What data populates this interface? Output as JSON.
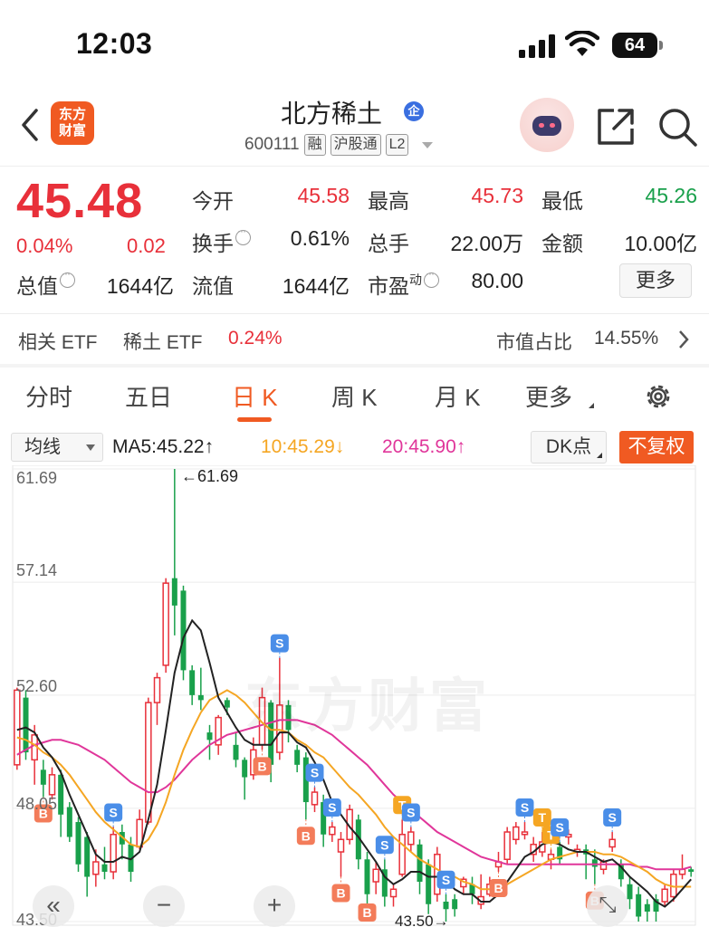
{
  "status": {
    "time": "12:03",
    "battery": "64"
  },
  "header": {
    "logo_line1": "东方",
    "logo_line2": "财富",
    "stock_name": "北方稀土",
    "badge": "企",
    "code": "600111",
    "tags": [
      "融",
      "沪股通",
      "L2"
    ]
  },
  "quote": {
    "price": "45.48",
    "change_pct": "0.04%",
    "change_val": "0.02",
    "fields": {
      "open_label": "今开",
      "open": "45.58",
      "high_label": "最高",
      "high": "45.73",
      "low_label": "最低",
      "low": "45.26",
      "turnover_label": "换手",
      "turnover": "0.61%",
      "volume_label": "总手",
      "volume": "22.00万",
      "amount_label": "金额",
      "amount": "10.00亿",
      "mktcap_label": "总值",
      "mktcap": "1644亿",
      "float_label": "流值",
      "float": "1644亿",
      "pe_label": "市盈",
      "pe_sup": "动",
      "pe": "80.00"
    },
    "more_label": "更多"
  },
  "etf": {
    "related": "相关 ETF",
    "rare_earth": "稀土 ETF",
    "rare_earth_pct": "0.24%",
    "mktcap_share_label": "市值占比",
    "mktcap_share": "14.55%"
  },
  "tabs": [
    "分时",
    "五日",
    "日 K",
    "周 K",
    "月 K",
    "更多"
  ],
  "active_tab": "日 K",
  "ma_row": {
    "indicator": "均线",
    "ma5": "MA5:45.22↑",
    "ma10": "10:45.29↓",
    "ma20": "20:45.90↑",
    "dk": "DK点",
    "adjust": "不复权"
  },
  "colors": {
    "up": "#e8303a",
    "down": "#19a04b",
    "accent": "#f05a22",
    "ma5": "#222222",
    "ma10": "#f5a623",
    "ma20": "#e0369a",
    "buy_marker": "#f37c5a",
    "sell_marker": "#4a8ee8",
    "t_marker": "#f5a623"
  },
  "chart_data": {
    "type": "candlestick",
    "y_axis_ticks": [
      "61.69",
      "57.14",
      "52.60",
      "48.05",
      "43.50"
    ],
    "ylim": [
      43.5,
      61.69
    ],
    "max_label": "61.69",
    "min_label": "43.50",
    "watermark": "东方财富",
    "candles": [
      {
        "o": 49.8,
        "c": 52.8,
        "h": 52.9,
        "l": 49.6
      },
      {
        "o": 52.5,
        "c": 50.3,
        "h": 52.8,
        "l": 50.0
      },
      {
        "o": 50.0,
        "c": 51.0,
        "h": 51.4,
        "l": 49.0
      },
      {
        "o": 49.6,
        "c": 49.0,
        "h": 50.0,
        "l": 48.5
      },
      {
        "o": 48.6,
        "c": 49.4,
        "h": 49.7,
        "l": 48.4
      },
      {
        "o": 49.4,
        "c": 47.8,
        "h": 49.6,
        "l": 46.9
      },
      {
        "o": 48.1,
        "c": 46.9,
        "h": 48.3,
        "l": 46.7
      },
      {
        "o": 47.5,
        "c": 45.8,
        "h": 47.7,
        "l": 45.5
      },
      {
        "o": 46.9,
        "c": 45.3,
        "h": 47.1,
        "l": 44.5
      },
      {
        "o": 45.4,
        "c": 45.9,
        "h": 46.4,
        "l": 44.9
      },
      {
        "o": 45.8,
        "c": 45.5,
        "h": 46.5,
        "l": 45.2
      },
      {
        "o": 45.5,
        "c": 47.0,
        "h": 47.3,
        "l": 45.2
      },
      {
        "o": 47.1,
        "c": 46.6,
        "h": 47.4,
        "l": 46.0
      },
      {
        "o": 46.6,
        "c": 45.5,
        "h": 46.9,
        "l": 45.1
      },
      {
        "o": 46.5,
        "c": 47.6,
        "h": 48.0,
        "l": 46.4
      },
      {
        "o": 47.5,
        "c": 52.3,
        "h": 52.5,
        "l": 47.4
      },
      {
        "o": 52.3,
        "c": 53.3,
        "h": 53.5,
        "l": 51.4
      },
      {
        "o": 53.8,
        "c": 57.1,
        "h": 57.3,
        "l": 53.5
      },
      {
        "o": 57.3,
        "c": 56.2,
        "h": 61.69,
        "l": 55.0
      },
      {
        "o": 56.8,
        "c": 53.6,
        "h": 57.0,
        "l": 53.2
      },
      {
        "o": 53.6,
        "c": 52.6,
        "h": 53.8,
        "l": 52.2
      },
      {
        "o": 52.6,
        "c": 52.4,
        "h": 53.7,
        "l": 52.0
      },
      {
        "o": 51.1,
        "c": 50.8,
        "h": 51.4,
        "l": 50.0
      },
      {
        "o": 50.6,
        "c": 51.7,
        "h": 51.8,
        "l": 50.2
      },
      {
        "o": 52.4,
        "c": 52.1,
        "h": 52.5,
        "l": 51.8
      },
      {
        "o": 50.6,
        "c": 50.0,
        "h": 51.1,
        "l": 49.7
      },
      {
        "o": 50.0,
        "c": 49.3,
        "h": 50.1,
        "l": 48.4
      },
      {
        "o": 49.4,
        "c": 50.4,
        "h": 50.9,
        "l": 49.2
      },
      {
        "o": 50.6,
        "c": 52.5,
        "h": 52.9,
        "l": 50.4
      },
      {
        "o": 52.3,
        "c": 49.8,
        "h": 52.4,
        "l": 49.1
      },
      {
        "o": 50.3,
        "c": 52.2,
        "h": 54.1,
        "l": 50.0
      },
      {
        "o": 52.2,
        "c": 51.2,
        "h": 52.4,
        "l": 50.7
      },
      {
        "o": 50.4,
        "c": 49.8,
        "h": 50.6,
        "l": 49.5
      },
      {
        "o": 50.1,
        "c": 48.3,
        "h": 50.3,
        "l": 47.6
      },
      {
        "o": 48.2,
        "c": 48.7,
        "h": 48.9,
        "l": 47.9
      },
      {
        "o": 48.3,
        "c": 47.0,
        "h": 48.6,
        "l": 46.5
      },
      {
        "o": 47.0,
        "c": 47.3,
        "h": 47.5,
        "l": 46.7
      },
      {
        "o": 46.3,
        "c": 46.8,
        "h": 47.1,
        "l": 45.3
      },
      {
        "o": 46.8,
        "c": 48.0,
        "h": 48.2,
        "l": 46.6
      },
      {
        "o": 47.6,
        "c": 46.0,
        "h": 47.8,
        "l": 45.6
      },
      {
        "o": 46.0,
        "c": 44.6,
        "h": 46.3,
        "l": 44.2
      },
      {
        "o": 45.1,
        "c": 45.6,
        "h": 45.9,
        "l": 44.6
      },
      {
        "o": 45.6,
        "c": 44.5,
        "h": 46.0,
        "l": 44.1
      },
      {
        "o": 44.5,
        "c": 44.8,
        "h": 45.0,
        "l": 44.1
      },
      {
        "o": 45.4,
        "c": 47.0,
        "h": 47.6,
        "l": 45.3
      },
      {
        "o": 46.6,
        "c": 47.1,
        "h": 47.3,
        "l": 46.3
      },
      {
        "o": 46.6,
        "c": 45.1,
        "h": 46.8,
        "l": 44.6
      },
      {
        "o": 45.8,
        "c": 44.2,
        "h": 46.0,
        "l": 43.8
      },
      {
        "o": 44.6,
        "c": 46.2,
        "h": 46.5,
        "l": 44.3
      },
      {
        "o": 44.3,
        "c": 44.0,
        "h": 44.6,
        "l": 43.5
      },
      {
        "o": 44.4,
        "c": 44.0,
        "h": 44.6,
        "l": 43.7
      },
      {
        "o": 44.9,
        "c": 45.2,
        "h": 45.3,
        "l": 44.6
      },
      {
        "o": 45.0,
        "c": 44.6,
        "h": 45.3,
        "l": 44.2
      },
      {
        "o": 44.2,
        "c": 44.5,
        "h": 45.4,
        "l": 44.0
      },
      {
        "o": 44.6,
        "c": 45.0,
        "h": 45.3,
        "l": 44.5
      },
      {
        "o": 45.7,
        "c": 45.9,
        "h": 46.3,
        "l": 45.5
      },
      {
        "o": 46.0,
        "c": 47.1,
        "h": 47.3,
        "l": 45.8
      },
      {
        "o": 46.8,
        "c": 47.3,
        "h": 47.5,
        "l": 46.6
      },
      {
        "o": 47.0,
        "c": 47.1,
        "h": 47.5,
        "l": 46.8
      },
      {
        "o": 46.2,
        "c": 46.6,
        "h": 46.9,
        "l": 45.9
      },
      {
        "o": 46.3,
        "c": 46.7,
        "h": 47.1,
        "l": 46.1
      },
      {
        "o": 46.0,
        "c": 46.2,
        "h": 46.4,
        "l": 45.6
      },
      {
        "o": 46.5,
        "c": 46.0,
        "h": 46.7,
        "l": 45.8
      },
      {
        "o": 46.9,
        "c": 47.0,
        "h": 47.2,
        "l": 46.6
      },
      {
        "o": 46.3,
        "c": 46.4,
        "h": 46.6,
        "l": 46.1
      },
      {
        "o": 46.4,
        "c": 46.2,
        "h": 46.6,
        "l": 45.2
      },
      {
        "o": 46.0,
        "c": 45.7,
        "h": 46.4,
        "l": 45.0
      },
      {
        "o": 45.6,
        "c": 45.9,
        "h": 46.0,
        "l": 45.4
      },
      {
        "o": 46.5,
        "c": 46.8,
        "h": 47.1,
        "l": 46.3
      },
      {
        "o": 45.8,
        "c": 45.2,
        "h": 46.0,
        "l": 44.9
      },
      {
        "o": 45.0,
        "c": 44.4,
        "h": 45.3,
        "l": 44.0
      },
      {
        "o": 44.6,
        "c": 43.7,
        "h": 44.9,
        "l": 43.5
      },
      {
        "o": 44.2,
        "c": 43.9,
        "h": 44.4,
        "l": 43.5
      },
      {
        "o": 44.4,
        "c": 43.9,
        "h": 44.6,
        "l": 43.5
      },
      {
        "o": 44.3,
        "c": 44.8,
        "h": 45.0,
        "l": 44.1
      },
      {
        "o": 44.5,
        "c": 45.4,
        "h": 45.6,
        "l": 44.3
      },
      {
        "o": 45.4,
        "c": 45.6,
        "h": 46.2,
        "l": 45.2
      },
      {
        "o": 45.6,
        "c": 45.5,
        "h": 45.7,
        "l": 45.3
      }
    ],
    "ma5": [
      51.2,
      51.3,
      51.1,
      50.5,
      50.1,
      49.5,
      48.6,
      47.8,
      47.0,
      46.2,
      45.9,
      45.9,
      46.1,
      46.0,
      46.3,
      47.6,
      49.0,
      51.2,
      53.5,
      54.9,
      55.6,
      55.2,
      53.9,
      52.5,
      51.9,
      51.3,
      50.8,
      50.6,
      50.6,
      50.6,
      51.1,
      51.1,
      50.7,
      50.5,
      49.9,
      49.2,
      48.3,
      47.8,
      47.3,
      46.9,
      46.4,
      45.9,
      45.3,
      45.0,
      45.2,
      45.5,
      45.5,
      45.3,
      45.3,
      45.2,
      44.8,
      44.6,
      44.6,
      44.3,
      44.3,
      44.6,
      45.1,
      45.6,
      46.1,
      46.3,
      46.6,
      46.7,
      46.6,
      46.4,
      46.3,
      46.3,
      46.1,
      45.9,
      46.0,
      45.7,
      45.3,
      45.0,
      44.7,
      44.3,
      44.1,
      44.4,
      44.8,
      45.2
    ],
    "ma10": [
      50.9,
      50.8,
      50.6,
      50.3,
      50.1,
      49.8,
      49.4,
      48.9,
      48.4,
      47.9,
      47.5,
      47.2,
      46.9,
      46.6,
      46.5,
      46.8,
      47.4,
      48.3,
      49.4,
      50.4,
      51.2,
      51.9,
      52.4,
      52.6,
      52.8,
      52.6,
      52.3,
      51.9,
      51.5,
      51.2,
      51.2,
      51.1,
      50.8,
      50.6,
      50.3,
      50.1,
      49.7,
      49.3,
      48.9,
      48.6,
      48.2,
      47.8,
      47.3,
      46.9,
      46.6,
      46.3,
      46.0,
      45.8,
      45.6,
      45.4,
      45.3,
      45.1,
      45.0,
      44.8,
      44.8,
      44.9,
      45.0,
      45.2,
      45.4,
      45.6,
      45.8,
      46.0,
      46.1,
      46.2,
      46.3,
      46.3,
      46.3,
      46.2,
      46.2,
      46.1,
      45.9,
      45.7,
      45.5,
      45.2,
      45.0,
      44.9,
      44.9,
      44.9
    ],
    "ma20": [
      50.2,
      50.4,
      50.6,
      50.7,
      50.8,
      50.8,
      50.7,
      50.6,
      50.4,
      50.2,
      50.0,
      49.7,
      49.4,
      49.1,
      48.9,
      48.7,
      48.7,
      48.9,
      49.2,
      49.6,
      50.0,
      50.3,
      50.6,
      50.8,
      51.0,
      51.1,
      51.2,
      51.3,
      51.4,
      51.5,
      51.6,
      51.6,
      51.6,
      51.5,
      51.4,
      51.2,
      51.0,
      50.7,
      50.4,
      50.1,
      49.8,
      49.4,
      49.0,
      48.6,
      48.3,
      48.0,
      47.7,
      47.4,
      47.1,
      46.9,
      46.7,
      46.5,
      46.3,
      46.1,
      46.0,
      45.9,
      45.8,
      45.8,
      45.8,
      45.8,
      45.8,
      45.8,
      45.8,
      45.8,
      45.8,
      45.8,
      45.8,
      45.8,
      45.8,
      45.8,
      45.8,
      45.7,
      45.7,
      45.6,
      45.6,
      45.6,
      45.6,
      45.7
    ]
  },
  "signals": [
    {
      "i": 3,
      "type": "B"
    },
    {
      "i": 11,
      "type": "S"
    },
    {
      "i": 28,
      "type": "B"
    },
    {
      "i": 30,
      "type": "S"
    },
    {
      "i": 33,
      "type": "B"
    },
    {
      "i": 34,
      "type": "S"
    },
    {
      "i": 36,
      "type": "S"
    },
    {
      "i": 37,
      "type": "B"
    },
    {
      "i": 40,
      "type": "B"
    },
    {
      "i": 42,
      "type": "S"
    },
    {
      "i": 44,
      "type": "T"
    },
    {
      "i": 45,
      "type": "S"
    },
    {
      "i": 49,
      "type": "S"
    },
    {
      "i": 55,
      "type": "B"
    },
    {
      "i": 58,
      "type": "S"
    },
    {
      "i": 60,
      "type": "T"
    },
    {
      "i": 61,
      "type": "T"
    },
    {
      "i": 62,
      "type": "S"
    },
    {
      "i": 66,
      "type": "B"
    },
    {
      "i": 68,
      "type": "S"
    }
  ],
  "float_buttons": [
    "«",
    "−",
    "+",
    "⤡"
  ]
}
